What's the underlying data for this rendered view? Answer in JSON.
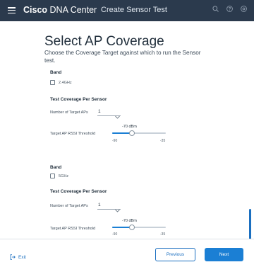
{
  "header": {
    "brand_bold": "Cisco",
    "brand_light": "DNA Center",
    "page_heading": "Create Sensor Test",
    "icons": [
      "menu-icon",
      "search-icon",
      "help-icon",
      "settings-icon"
    ]
  },
  "main": {
    "title": "Select AP Coverage",
    "subtitle": "Choose the Coverage Target against which to run the Sensor test.",
    "sections": [
      {
        "band_label": "Band",
        "band_option": "2.4GHz",
        "band_checked": false,
        "coverage_label": "Test Coverage Per Sensor",
        "target_aps_label": "Number of Target APs",
        "target_aps_value": "1",
        "rssi_label": "Target AP RSSI Threshold",
        "rssi_value_label": "-70 dBm",
        "rssi_value": -70,
        "rssi_min": "-90",
        "rssi_max": "-35"
      },
      {
        "band_label": "Band",
        "band_option": "5GHz",
        "band_checked": false,
        "coverage_label": "Test Coverage Per Sensor",
        "target_aps_label": "Number of Target APs",
        "target_aps_value": "1",
        "rssi_label": "Target AP RSSI Threshold",
        "rssi_value_label": "-70 dBm",
        "rssi_value": -70,
        "rssi_min": "-90",
        "rssi_max": "-35"
      }
    ]
  },
  "footer": {
    "exit_label": "Exit",
    "previous_label": "Previous",
    "next_label": "Next"
  },
  "colors": {
    "header_bg": "#2b3a4d",
    "accent": "#1b7fd4",
    "link": "#1b6fc0"
  }
}
